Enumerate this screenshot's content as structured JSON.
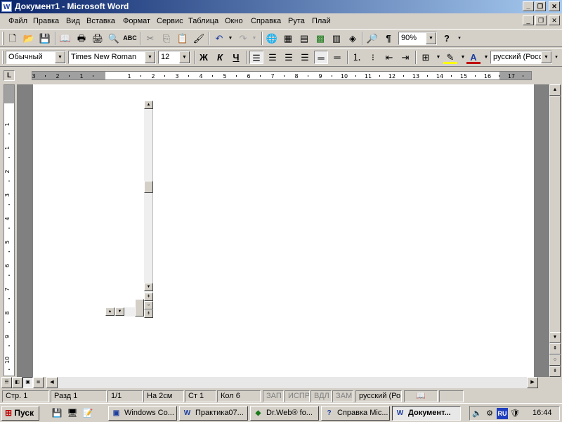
{
  "window": {
    "app_icon": "W",
    "title": "Документ1 - Microsoft Word",
    "minimize": "_",
    "maximize": "❐",
    "close": "✕"
  },
  "menu": {
    "items": [
      "Файл",
      "Правка",
      "Вид",
      "Вставка",
      "Формат",
      "Сервис",
      "Таблица",
      "Окно",
      "Справка",
      "Рута",
      "Плай"
    ],
    "doc_minimize": "_",
    "doc_restore": "❐",
    "doc_close": "✕"
  },
  "standard_toolbar": {
    "zoom": "90%",
    "icons": [
      "new-document-icon",
      "open-folder-icon",
      "save-icon",
      "open-book-icon",
      "print-icon",
      "print-preview-icon",
      "spelling-icon",
      "cut-icon",
      "copy-icon",
      "paste-icon",
      "format-painter-icon",
      "undo-icon",
      "redo-icon",
      "hyperlink-icon",
      "tables-borders-icon",
      "insert-table-icon",
      "insert-excel-icon",
      "columns-icon",
      "drawing-icon",
      "document-map-icon",
      "show-formatting-icon",
      "help-icon"
    ]
  },
  "formatting_toolbar": {
    "style": "Обычный",
    "font": "Times New Roman",
    "size": "12",
    "bold": "Ж",
    "italic": "К",
    "underline": "Ч",
    "language": "русский (Росс"
  },
  "ruler": {
    "tab_selector": "L",
    "horizontal_labels": [
      "3",
      "2",
      "1",
      "1",
      "2",
      "3",
      "4",
      "5",
      "6",
      "7",
      "8",
      "9",
      "10",
      "11",
      "12",
      "13",
      "14",
      "15",
      "16",
      "17"
    ],
    "vertical_labels": [
      "1",
      "1",
      "2",
      "3",
      "4",
      "5",
      "6",
      "7",
      "8",
      "9",
      "10",
      "11"
    ]
  },
  "status": {
    "page": "Стр.  1",
    "section": "Разд  1",
    "pages": "1/1",
    "at": "На  2см",
    "line": "Ст  1",
    "col": "Кол  6",
    "rec": "ЗАП",
    "trk": "ИСПР",
    "ext": "ВДЛ",
    "ovr": "ЗАМ",
    "language": "русский (Ро"
  },
  "taskbar": {
    "start": "Пуск",
    "tasks": [
      {
        "label": "Windows Co...",
        "icon": "window-icon"
      },
      {
        "label": "Практика07...",
        "icon": "word-doc-icon"
      },
      {
        "label": "Dr.Web® fo...",
        "icon": "drweb-icon"
      },
      {
        "label": "Справка Mic...",
        "icon": "help-icon"
      },
      {
        "label": "Документ...",
        "icon": "word-doc-icon"
      }
    ],
    "lang": "RU",
    "clock": "16:44"
  }
}
